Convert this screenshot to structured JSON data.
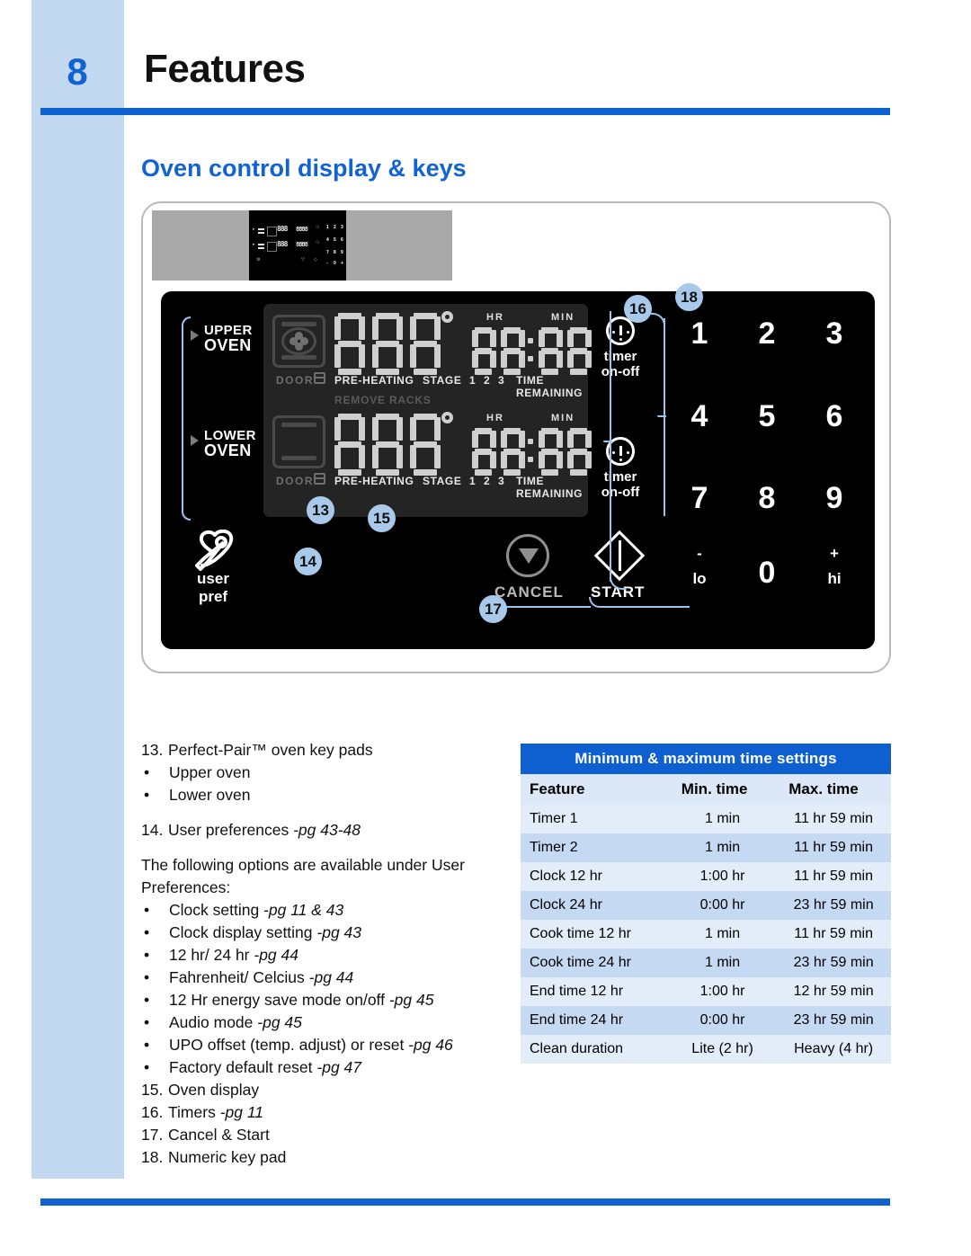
{
  "page": {
    "number": "8",
    "title": "Features",
    "section_title": "Oven control display & keys"
  },
  "panel": {
    "upper_oven_label_1": "UPPER",
    "upper_oven_label_2": "OVEN",
    "lower_oven_label_1": "LOWER",
    "lower_oven_label_2": "OVEN",
    "door_label": "DOOR",
    "preheating": "PRE-HEATING",
    "stage": "STAGE",
    "stage_numbers": [
      "1",
      "2",
      "3"
    ],
    "time_remaining": "TIME REMAINING",
    "remove_racks": "REMOVE RACKS",
    "hr": "HR",
    "min": "MIN",
    "temp_value": "888",
    "time_value": "88:88",
    "timer_label_1": "timer",
    "timer_label_2": "on-off",
    "user_pref_1": "user",
    "user_pref_2": "pref",
    "cancel": "CANCEL",
    "start": "START",
    "keys": [
      "1",
      "2",
      "3",
      "4",
      "5",
      "6",
      "7",
      "8",
      "9"
    ],
    "key_minus": "-",
    "key_lo": "lo",
    "key_zero": "0",
    "key_plus": "+",
    "key_hi": "hi",
    "callouts": [
      "13",
      "14",
      "15",
      "16",
      "17",
      "18"
    ]
  },
  "legend": {
    "item13": {
      "n": "13.",
      "text": "Perfect-Pair™ oven key pads"
    },
    "item13_bullets": [
      "Upper oven",
      "Lower oven"
    ],
    "item14": {
      "n": "14.",
      "text": "User preferences ",
      "pg": "-pg 43-48"
    },
    "intro": "The following options are available under User Preferences:",
    "pref_bullets": [
      {
        "text": "Clock setting ",
        "pg": "-pg 11 & 43"
      },
      {
        "text": "Clock display setting ",
        "pg": "-pg 43"
      },
      {
        "text": "12 hr/ 24 hr ",
        "pg": "-pg 44"
      },
      {
        "text": "Fahrenheit/ Celcius ",
        "pg": "-pg 44"
      },
      {
        "text": "12 Hr energy save mode on/off ",
        "pg": "-pg 45"
      },
      {
        "text": "Audio mode ",
        "pg": "-pg 45"
      },
      {
        "text": "UPO offset (temp. adjust) or reset ",
        "pg": "-pg 46"
      },
      {
        "text": "Factory default reset ",
        "pg": "-pg 47"
      }
    ],
    "item15": {
      "n": "15.",
      "text": "Oven  display",
      "pg": ""
    },
    "item16": {
      "n": "16.",
      "text": "Timers ",
      "pg": "-pg 11"
    },
    "item17": {
      "n": "17.",
      "text": "Cancel & Start",
      "pg": ""
    },
    "item18": {
      "n": "18.",
      "text": "Numeric key pad",
      "pg": ""
    }
  },
  "table": {
    "caption": "Minimum & maximum time settings",
    "headers": [
      "Feature",
      "Min. time",
      "Max. time"
    ],
    "rows": [
      [
        "Timer 1",
        "1 min",
        "11 hr 59 min"
      ],
      [
        "Timer 2",
        "1 min",
        "11 hr 59 min"
      ],
      [
        "Clock 12 hr",
        "1:00 hr",
        "11 hr 59 min"
      ],
      [
        "Clock 24 hr",
        "0:00 hr",
        "23 hr 59 min"
      ],
      [
        "Cook time 12 hr",
        "1 min",
        "11 hr 59 min"
      ],
      [
        "Cook time 24 hr",
        "1 min",
        "23 hr 59 min"
      ],
      [
        "End time 12 hr",
        "1:00 hr",
        "12 hr 59 min"
      ],
      [
        "End time 24 hr",
        "0:00 hr",
        "23 hr 59 min"
      ],
      [
        "Clean duration",
        "Lite (2 hr)",
        "Heavy (4 hr)"
      ]
    ]
  },
  "colors": {
    "accent": "#0e62d0",
    "band": "#c3d9f2",
    "callout": "#a9c9ea",
    "panel": "#000000"
  }
}
